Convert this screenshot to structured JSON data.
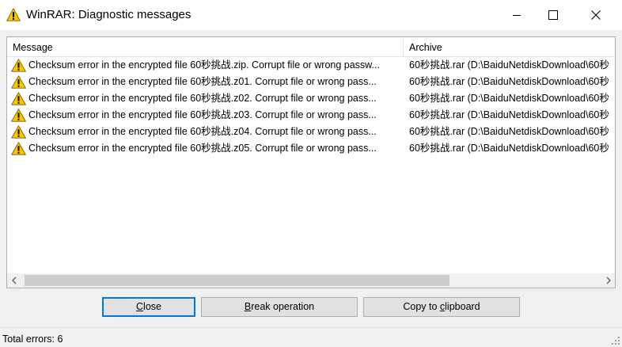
{
  "window": {
    "title": "WinRAR: Diagnostic messages",
    "icon": "warning-triangle-icon"
  },
  "columns": {
    "message": "Message",
    "archive": "Archive"
  },
  "rows": [
    {
      "icon": "warning-icon",
      "message": "Checksum error in the encrypted file 60秒挑战.zip. Corrupt file or wrong passw...",
      "archive": "60秒挑战.rar (D:\\BaiduNetdiskDownload\\60秒"
    },
    {
      "icon": "warning-icon",
      "message": "Checksum error in the encrypted file 60秒挑战.z01. Corrupt file or wrong pass...",
      "archive": "60秒挑战.rar (D:\\BaiduNetdiskDownload\\60秒"
    },
    {
      "icon": "warning-icon",
      "message": "Checksum error in the encrypted file 60秒挑战.z02. Corrupt file or wrong pass...",
      "archive": "60秒挑战.rar (D:\\BaiduNetdiskDownload\\60秒"
    },
    {
      "icon": "warning-icon",
      "message": "Checksum error in the encrypted file 60秒挑战.z03. Corrupt file or wrong pass...",
      "archive": "60秒挑战.rar (D:\\BaiduNetdiskDownload\\60秒"
    },
    {
      "icon": "warning-icon",
      "message": "Checksum error in the encrypted file 60秒挑战.z04. Corrupt file or wrong pass...",
      "archive": "60秒挑战.rar (D:\\BaiduNetdiskDownload\\60秒"
    },
    {
      "icon": "warning-icon",
      "message": "Checksum error in the encrypted file 60秒挑战.z05. Corrupt file or wrong pass...",
      "archive": "60秒挑战.rar (D:\\BaiduNetdiskDownload\\60秒"
    }
  ],
  "buttons": {
    "close": {
      "mnemonic": "C",
      "rest": "lose"
    },
    "break": {
      "mnemonic": "B",
      "rest": "reak operation"
    },
    "copy": {
      "pre": "Copy to ",
      "mnemonic": "c",
      "rest": "lipboard"
    }
  },
  "status": {
    "total_errors": "Total errors: 6"
  },
  "colors": {
    "warning_fill": "#f7c600",
    "accent": "#0078d7"
  }
}
